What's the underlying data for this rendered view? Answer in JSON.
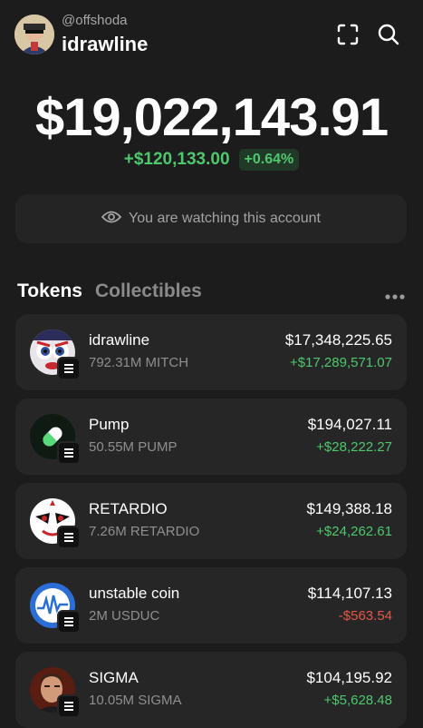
{
  "header": {
    "handle": "@offshoda",
    "account_name": "idrawline"
  },
  "portfolio": {
    "balance": "$19,022,143.91",
    "change_abs": "+$120,133.00",
    "change_pct": "+0.64%"
  },
  "watch_banner": {
    "text": "You are watching this account"
  },
  "tabs": [
    {
      "label": "Tokens",
      "active": true
    },
    {
      "label": "Collectibles",
      "active": false
    }
  ],
  "tokens": [
    {
      "name": "idrawline",
      "amount": "792.31M MITCH",
      "value": "$17,348,225.65",
      "pnl": "+$17,289,571.07",
      "direction": "up"
    },
    {
      "name": "Pump",
      "amount": "50.55M PUMP",
      "value": "$194,027.11",
      "pnl": "+$28,222.27",
      "direction": "up"
    },
    {
      "name": "RETARDIO",
      "amount": "7.26M RETARDIO",
      "value": "$149,388.18",
      "pnl": "+$24,262.61",
      "direction": "up"
    },
    {
      "name": "unstable coin",
      "amount": "2M USDUC",
      "value": "$114,107.13",
      "pnl": "-$563.54",
      "direction": "down"
    },
    {
      "name": "SIGMA",
      "amount": "10.05M SIGMA",
      "value": "$104,195.92",
      "pnl": "+$5,628.48",
      "direction": "up"
    }
  ],
  "colors": {
    "background": "#1c1c1c",
    "card": "#262626",
    "positive": "#4fc76e",
    "negative": "#e5564a"
  }
}
